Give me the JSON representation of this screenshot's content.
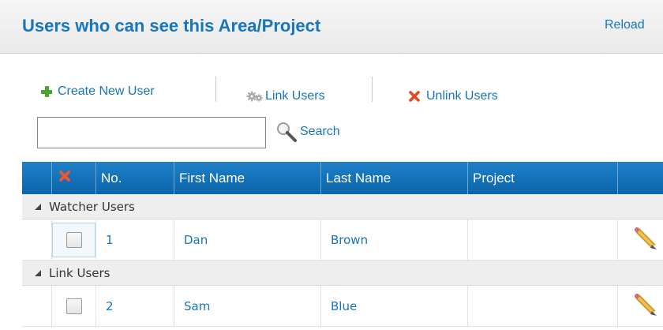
{
  "header": {
    "title": "Users who can see this Area/Project",
    "reload_label": "Reload"
  },
  "toolbar": {
    "create_label": "Create New User",
    "link_label": "Link Users",
    "unlink_label": "Unlink Users"
  },
  "search": {
    "value": "",
    "placeholder": "",
    "button_label": "Search"
  },
  "grid": {
    "columns": [
      "No.",
      "First Name",
      "Last Name",
      "Project"
    ],
    "groups": [
      {
        "label": "Watcher Users",
        "rows": [
          {
            "no": "1",
            "first_name": "Dan",
            "last_name": "Brown",
            "project": ""
          }
        ]
      },
      {
        "label": "Link Users",
        "rows": [
          {
            "no": "2",
            "first_name": "Sam",
            "last_name": "Blue",
            "project": ""
          }
        ]
      }
    ]
  },
  "colors": {
    "accent": "#1776be",
    "grid_header": "#0a65aa",
    "add_green": "#4aa52e",
    "delete_red": "#e04a2a"
  },
  "icons": {
    "create": "plus-icon",
    "link": "gear-icon",
    "unlink": "x-icon",
    "search": "search-icon",
    "edit": "pencil-icon",
    "header_delete": "x-icon",
    "group_toggle": "collapse-arrow-icon"
  }
}
